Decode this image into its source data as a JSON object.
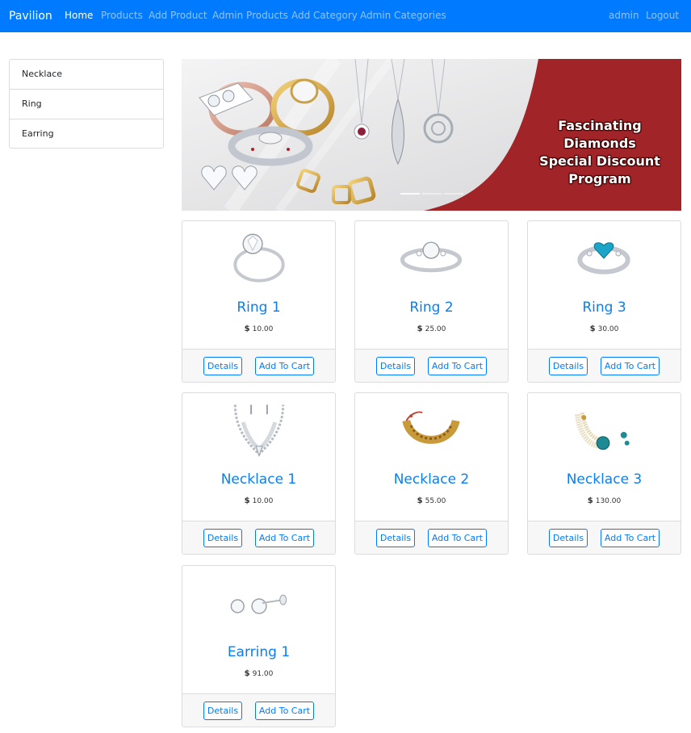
{
  "navbar": {
    "brand": "Pavilion",
    "links": [
      "Home",
      "Products",
      "Add Product",
      "Admin Products",
      "Add Category",
      "Admin Categories"
    ],
    "right_links": [
      "admin",
      "Logout"
    ],
    "bg_color": "#007bff"
  },
  "sidebar": {
    "items": [
      "Necklace",
      "Ring",
      "Earring"
    ]
  },
  "banner": {
    "line1": "Fascinating Diamonds",
    "line2": "Special Discount",
    "line3": "Program",
    "accent_color": "#a12528"
  },
  "products": [
    {
      "name": "Ring 1",
      "currency": "$",
      "price": "10.00",
      "details_label": "Details",
      "cart_label": "Add To Cart",
      "image": "ring-image"
    },
    {
      "name": "Ring 2",
      "currency": "$",
      "price": "25.00",
      "details_label": "Details",
      "cart_label": "Add To Cart",
      "image": "ring-image"
    },
    {
      "name": "Ring 3",
      "currency": "$",
      "price": "30.00",
      "details_label": "Details",
      "cart_label": "Add To Cart",
      "image": "ring-image"
    },
    {
      "name": "Necklace 1",
      "currency": "$",
      "price": "10.00",
      "details_label": "Details",
      "cart_label": "Add To Cart",
      "image": "necklace-image"
    },
    {
      "name": "Necklace 2",
      "currency": "$",
      "price": "55.00",
      "details_label": "Details",
      "cart_label": "Add To Cart",
      "image": "necklace-image"
    },
    {
      "name": "Necklace 3",
      "currency": "$",
      "price": "130.00",
      "details_label": "Details",
      "cart_label": "Add To Cart",
      "image": "necklace-image"
    },
    {
      "name": "Earring 1",
      "currency": "$",
      "price": "91.00",
      "details_label": "Details",
      "cart_label": "Add To Cart",
      "image": "earring-image"
    }
  ]
}
